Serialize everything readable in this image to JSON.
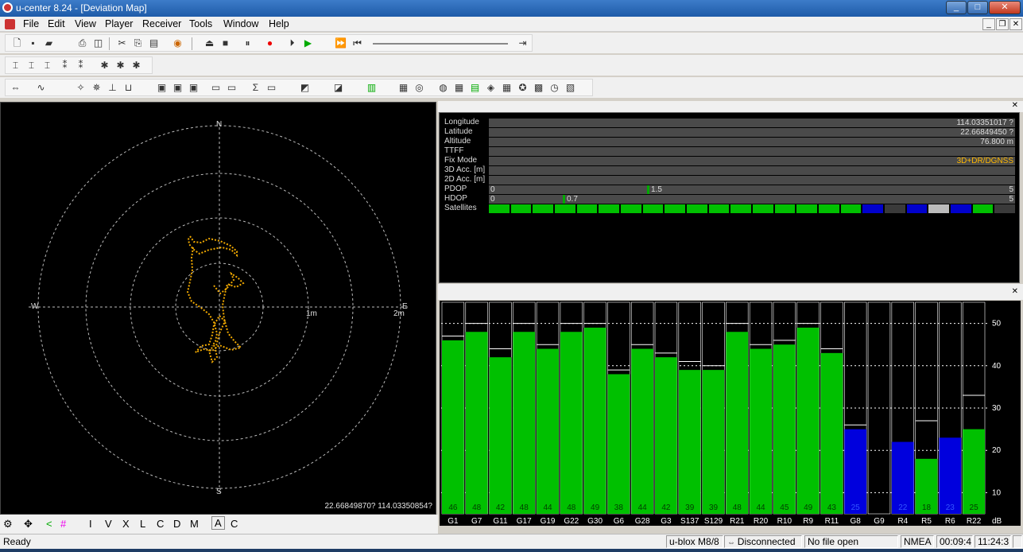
{
  "window": {
    "title": "u-center 8.24 - [Deviation Map]",
    "min": "_",
    "max": "□",
    "close": "✕"
  },
  "menu": [
    "File",
    "Edit",
    "View",
    "Player",
    "Receiver",
    "Tools",
    "Window",
    "Help"
  ],
  "mdi": {
    "min": "_",
    "restore": "❐",
    "close": "✕"
  },
  "map": {
    "compass": {
      "n": "N",
      "s": "S",
      "e": "E",
      "w": "W"
    },
    "ring_labels": [
      "1m",
      "2m"
    ],
    "coord": "22.66849870? 114.03350854?",
    "track_color": "#f0a800"
  },
  "info": {
    "rows": [
      {
        "label": "Longitude",
        "value": "114.03351017 ?"
      },
      {
        "label": "Latitude",
        "value": "22.66849450 ?"
      },
      {
        "label": "Altitude",
        "value": "76.800 m"
      },
      {
        "label": "TTFF",
        "value": ""
      },
      {
        "label": "Fix Mode",
        "value": "3D+DR/DGNSS"
      },
      {
        "label": "3D Acc. [m]",
        "value": ""
      },
      {
        "label": "2D Acc. [m]",
        "value": ""
      }
    ],
    "pdop": {
      "label": "PDOP",
      "min": "0",
      "max": "5",
      "value": "1.5",
      "level": 0.3
    },
    "hdop": {
      "label": "HDOP",
      "min": "0",
      "max": "5",
      "value": "0.7",
      "level": 0.14
    },
    "satellites_label": "Satellites"
  },
  "chart_data": {
    "type": "bar",
    "categories": [
      "G1",
      "G7",
      "G11",
      "G17",
      "G19",
      "G22",
      "G30",
      "G6",
      "G28",
      "G3",
      "S137",
      "S129",
      "R21",
      "R20",
      "R10",
      "R9",
      "R11",
      "G8",
      "G9",
      "R4",
      "R5",
      "R6",
      "R22"
    ],
    "values": [
      46,
      48,
      42,
      48,
      44,
      48,
      49,
      38,
      44,
      42,
      39,
      39,
      48,
      44,
      45,
      49,
      43,
      null,
      null,
      null,
      18,
      null,
      25
    ],
    "value_labels": [
      "46",
      "48",
      "42",
      "48",
      "44",
      "48",
      "49",
      "38",
      "44",
      "42",
      "39",
      "39",
      "48",
      "44",
      "45",
      "49",
      "43",
      "25",
      "",
      "22",
      "18",
      "23",
      "25"
    ],
    "approx_heights": [
      46,
      48,
      42,
      48,
      44,
      48,
      49,
      38,
      44,
      42,
      39,
      39,
      48,
      44,
      45,
      49,
      43,
      25,
      0,
      22,
      18,
      23,
      25
    ],
    "bar_colors": [
      "green",
      "green",
      "green",
      "green",
      "green",
      "green",
      "green",
      "green",
      "green",
      "green",
      "green",
      "green",
      "green",
      "green",
      "green",
      "green",
      "green",
      "blue",
      "none",
      "blue",
      "green",
      "blue",
      "green"
    ],
    "peak_marks": [
      47,
      50,
      44,
      50,
      45,
      50,
      50,
      39,
      45,
      43,
      41,
      40,
      50,
      45,
      46,
      50,
      44,
      26,
      0,
      0,
      27,
      0,
      33
    ],
    "ylim": [
      5,
      55
    ],
    "yticks": [
      "10",
      "20",
      "30",
      "40",
      "50"
    ],
    "unit": "dB",
    "colors": {
      "green": "#00c000",
      "blue": "#0000dd",
      "grid": "#ffffff"
    }
  },
  "bottombar": [
    "I",
    "V",
    "X",
    "L",
    "C",
    "D",
    "M",
    "A",
    "C"
  ],
  "status": {
    "ready": "Ready",
    "device": "u-blox M8/8",
    "conn": "Disconnected",
    "file": "No file open",
    "proto": "NMEA",
    "elapsed": "00:09:4",
    "clock": "11:24:3"
  }
}
